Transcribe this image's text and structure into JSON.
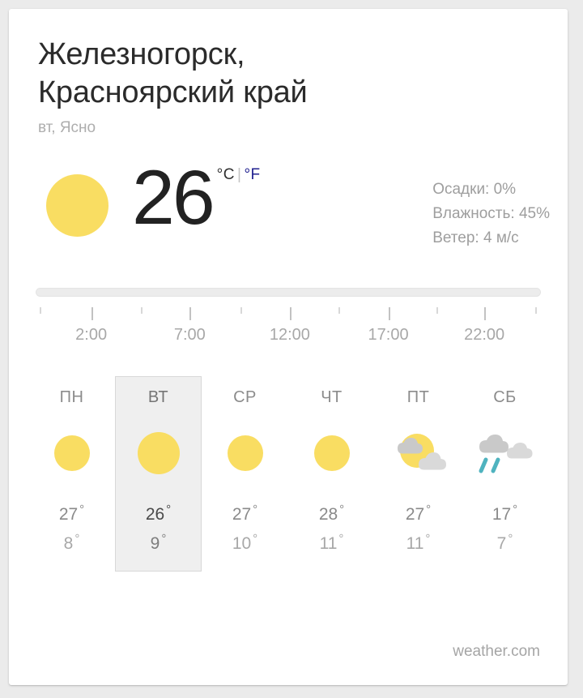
{
  "card": {
    "location": {
      "title": "Железногорск,\nКрасноярский край",
      "subtitle": "вт, Ясно"
    },
    "current": {
      "icon": "sun-icon",
      "temperature": "26",
      "unit_celsius": "°C",
      "unit_separator": "|",
      "unit_fahrenheit": "°F",
      "details": [
        "Осадки: 0%",
        "Влажность: 45%",
        "Ветер: 4 м/с"
      ]
    },
    "hourly": {
      "time_labels": [
        {
          "text": "2:00",
          "pos": 11.0
        },
        {
          "text": "7:00",
          "pos": 30.5
        },
        {
          "text": "12:00",
          "pos": 50.3
        },
        {
          "text": "17:00",
          "pos": 69.8
        },
        {
          "text": "22:00",
          "pos": 88.8
        }
      ],
      "ticks": [
        {
          "kind": "short",
          "pos": 0.8
        },
        {
          "kind": "tall",
          "pos": 11.0
        },
        {
          "kind": "short",
          "pos": 20.9
        },
        {
          "kind": "tall",
          "pos": 30.5
        },
        {
          "kind": "short",
          "pos": 40.5
        },
        {
          "kind": "tall",
          "pos": 50.3
        },
        {
          "kind": "short",
          "pos": 60.0
        },
        {
          "kind": "tall",
          "pos": 69.8
        },
        {
          "kind": "short",
          "pos": 79.4
        },
        {
          "kind": "tall",
          "pos": 88.8
        },
        {
          "kind": "short",
          "pos": 98.8
        }
      ]
    },
    "daily": [
      {
        "name": "ПН",
        "icon": "sun-icon",
        "high": "27",
        "low": "8",
        "selected": false
      },
      {
        "name": "ВТ",
        "icon": "sun-icon",
        "high": "26",
        "low": "9",
        "selected": true
      },
      {
        "name": "СР",
        "icon": "sun-icon",
        "high": "27",
        "low": "10",
        "selected": false
      },
      {
        "name": "ЧТ",
        "icon": "sun-icon",
        "high": "28",
        "low": "11",
        "selected": false
      },
      {
        "name": "ПТ",
        "icon": "partly-cloudy-icon",
        "high": "27",
        "low": "11",
        "selected": false
      },
      {
        "name": "СБ",
        "icon": "rain-icon",
        "high": "17",
        "low": "7",
        "selected": false
      }
    ],
    "degree_symbol": "°",
    "footer": "weather.com",
    "colors": {
      "sun": "#f9dd62",
      "cloud": "#c9c9c9",
      "cloud_light": "#d9d9d9",
      "rain": "#4fb3bf",
      "link": "#1f1f8f",
      "selected_bg": "#efefef"
    }
  }
}
